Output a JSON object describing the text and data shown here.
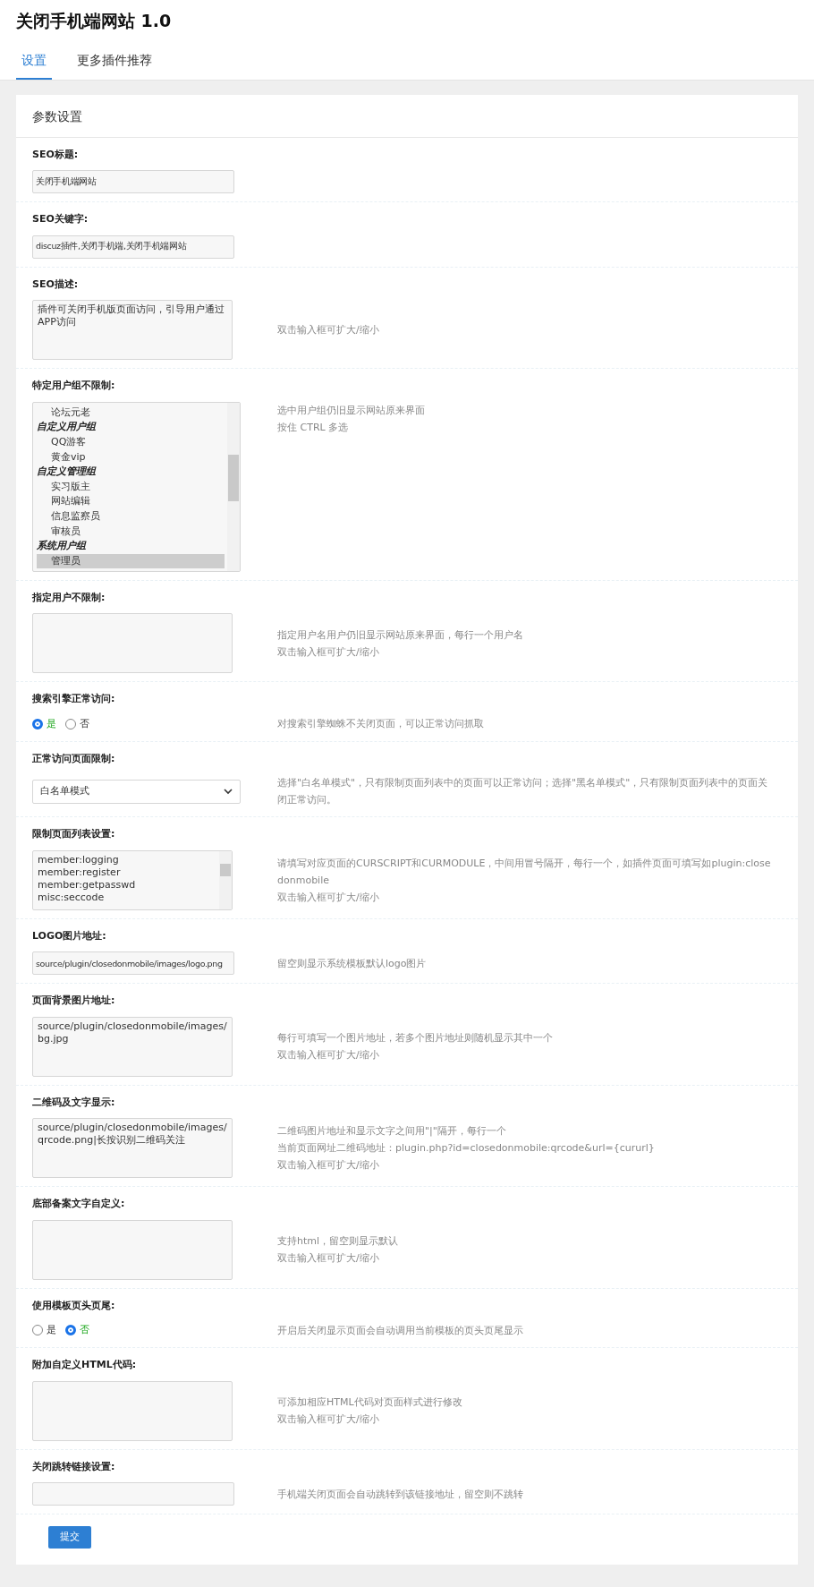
{
  "title": "关闭手机端网站 1.0",
  "tabs": [
    {
      "label": "设置",
      "selected": true
    },
    {
      "label": "更多插件推荐",
      "selected": false
    }
  ],
  "panel_title": "参数设置",
  "settings": [
    {
      "kind": "input",
      "label": "SEO标题:",
      "value": "关闭手机端网站"
    },
    {
      "kind": "input",
      "label": "SEO关键字:",
      "value": "discuz插件,关闭手机端,关闭手机端网站"
    },
    {
      "kind": "textarea",
      "label": "SEO描述:",
      "value": "插件可关闭手机版页面访问，引导用户通过APP访问",
      "hints": [
        "双击输入框可扩大/缩小"
      ]
    },
    {
      "kind": "multiselect",
      "label": "特定用户组不限制:",
      "options": [
        {
          "kind": "option",
          "text": "论坛元老",
          "selected": false
        },
        {
          "kind": "group",
          "text": "自定义用户组"
        },
        {
          "kind": "option",
          "text": "QQ游客",
          "selected": false
        },
        {
          "kind": "option",
          "text": "黄金vip",
          "selected": false
        },
        {
          "kind": "group",
          "text": "自定义管理组"
        },
        {
          "kind": "option",
          "text": "实习版主",
          "selected": false
        },
        {
          "kind": "option",
          "text": "网站编辑",
          "selected": false
        },
        {
          "kind": "option",
          "text": "信息监察员",
          "selected": false
        },
        {
          "kind": "option",
          "text": "审核员",
          "selected": false
        },
        {
          "kind": "group",
          "text": "系统用户组"
        },
        {
          "kind": "option",
          "text": "管理员",
          "selected": true
        }
      ],
      "hints": [
        "选中用户组仍旧显示网站原来界面",
        "按住 CTRL 多选"
      ]
    },
    {
      "kind": "textarea",
      "label": "指定用户不限制:",
      "hints": [
        "指定用户名用户仍旧显示网站原来界面，每行一个用户名",
        "双击输入框可扩大/缩小"
      ]
    },
    {
      "kind": "radio",
      "label": "搜索引擎正常访问:",
      "options": [
        {
          "text": "是",
          "selected": true
        },
        {
          "text": "否",
          "selected": false
        }
      ],
      "hints": [
        "对搜索引擎蜘蛛不关闭页面，可以正常访问抓取"
      ]
    },
    {
      "kind": "select",
      "label": "正常访问页面限制:",
      "value": "白名单模式",
      "hints": [
        "选择\"白名单模式\"，只有限制页面列表中的页面可以正常访问；选择\"黑名单模式\"，只有限制页面列表中的页面关闭正常访问。"
      ]
    },
    {
      "kind": "textarea",
      "label": "限制页面列表设置:",
      "value": "member:logging\nmember:register\nmember:getpasswd\nmisc:seccode",
      "scroll": true,
      "hints": [
        "请填写对应页面的CURSCRIPT和CURMODULE，中间用冒号隔开，每行一个，如插件页面可填写如plugin:closedonmobile",
        "双击输入框可扩大/缩小"
      ]
    },
    {
      "kind": "input",
      "label": "LOGO图片地址:",
      "value": "source/plugin/closedonmobile/images/logo.png",
      "hints": [
        "留空则显示系统模板默认logo图片"
      ]
    },
    {
      "kind": "textarea",
      "label": "页面背景图片地址:",
      "value": "source/plugin/closedonmobile/images/bg.jpg",
      "hints": [
        "每行可填写一个图片地址，若多个图片地址则随机显示其中一个",
        "双击输入框可扩大/缩小"
      ]
    },
    {
      "kind": "textarea",
      "label": "二维码及文字显示:",
      "value": "source/plugin/closedonmobile/images/qrcode.png|长按识别二维码关注",
      "hints": [
        "二维码图片地址和显示文字之间用\"|\"隔开，每行一个",
        "当前页面网址二维码地址：plugin.php?id=closedonmobile:qrcode&url={cururl}",
        "双击输入框可扩大/缩小"
      ]
    },
    {
      "kind": "textarea",
      "label": "底部备案文字自定义:",
      "hints": [
        "支持html，留空则显示默认",
        "双击输入框可扩大/缩小"
      ]
    },
    {
      "kind": "radio",
      "label": "使用模板页头页尾:",
      "options": [
        {
          "text": "是",
          "selected": false
        },
        {
          "text": "否",
          "selected": true
        }
      ],
      "hints": [
        "开启后关闭显示页面会自动调用当前模板的页头页尾显示"
      ]
    },
    {
      "kind": "textarea",
      "label": "附加自定义HTML代码:",
      "hints": [
        "可添加相应HTML代码对页面样式进行修改",
        "双击输入框可扩大/缩小"
      ]
    },
    {
      "kind": "input",
      "label": "关闭跳转链接设置:",
      "hints": [
        "手机端关闭页面会自动跳转到该链接地址，留空则不跳转"
      ]
    }
  ],
  "submit": "提交"
}
